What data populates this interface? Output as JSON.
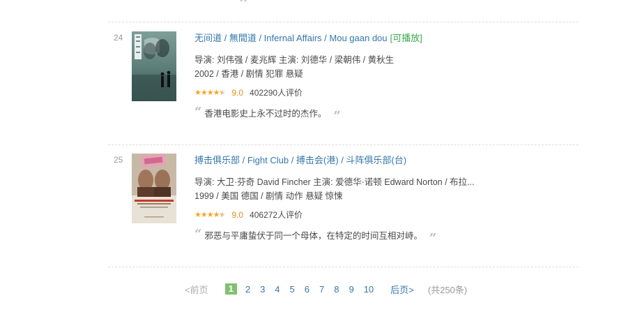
{
  "items": [
    {
      "rank": "24",
      "title_cn": "无间道",
      "title_other": " / 無間道 / Infernal Affairs / Mou gaan dou",
      "playable": "[可播放]",
      "credits": "导演: 刘伟强 / 麦兆辉   主演: 刘德华 / 梁朝伟 / 黄秋生",
      "meta": "2002 / 香港 / 剧情 犯罪 悬疑",
      "stars": 4.5,
      "rating": "9.0",
      "votes": "402290人评价",
      "quote": "香港电影史上永不过时的杰作。"
    },
    {
      "rank": "25",
      "title_cn": "搏击俱乐部",
      "title_other": " / Fight Club  / 搏击会(港) / 斗阵俱乐部(台)",
      "playable": "",
      "credits": "导演: 大卫·芬奇 David Fincher   主演: 爱德华·诺顿 Edward Norton / 布拉...",
      "meta": "1999 / 美国 德国 / 剧情 动作 悬疑 惊悚",
      "stars": 4.5,
      "rating": "9.0",
      "votes": "406272人评价",
      "quote": "邪恶与平庸蛰伏于同一个母体，在特定的时间互相对峙。"
    }
  ],
  "paginator": {
    "prev": "<前页",
    "current": "1",
    "pages": [
      "2",
      "3",
      "4",
      "5",
      "6",
      "7",
      "8",
      "9",
      "10"
    ],
    "next": "后页>",
    "count": "(共250条)"
  },
  "colors": {
    "link": "#3377aa",
    "playable": "#3ba94d",
    "star": "#f6a623",
    "current_page": "#83bf73"
  }
}
